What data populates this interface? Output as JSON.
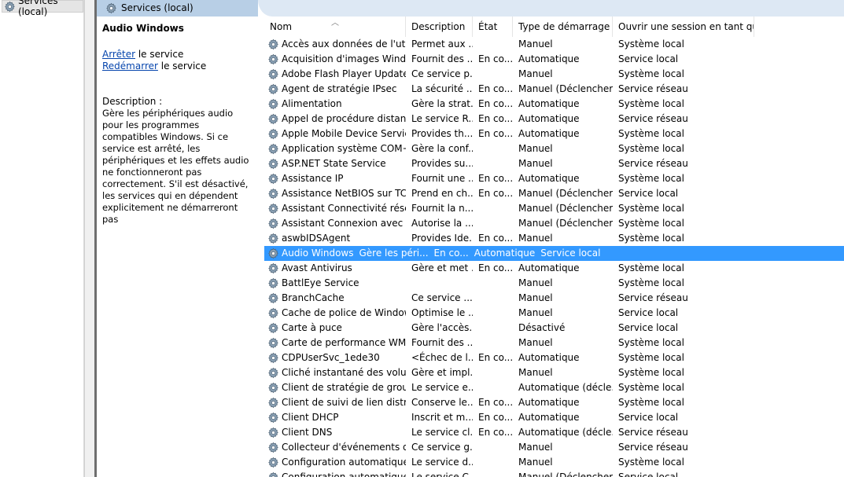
{
  "tree": {
    "root_label": "Services (local)"
  },
  "band": {
    "title": "Services (local)"
  },
  "details": {
    "service_name": "Audio Windows",
    "stop_link": "Arrêter",
    "stop_suffix": " le service",
    "restart_link": "Redémarrer",
    "restart_suffix": " le service",
    "description_label": "Description :",
    "description_text": "Gère les périphériques audio pour les programmes compatibles Windows. Si ce service est arrêté, les périphériques et les effets audio ne fonctionneront pas correctement. S'il est désactivé, les services qui en dépendent explicitement ne démarreront pas"
  },
  "columns": [
    "Nom",
    "Description",
    "État",
    "Type de démarrage",
    "Ouvrir une session en tant que"
  ],
  "selected_index": 14,
  "rows": [
    [
      "Accès aux données de l'utili...",
      "Permet aux ...",
      "",
      "Manuel",
      "Système local"
    ],
    [
      "Acquisition d'images Wind...",
      "Fournit des ...",
      "En co...",
      "Automatique",
      "Service local"
    ],
    [
      "Adobe Flash Player Update ...",
      "Ce service p...",
      "",
      "Manuel",
      "Système local"
    ],
    [
      "Agent de stratégie IPsec",
      "La sécurité ...",
      "En co...",
      "Manuel (Déclencher...",
      "Service réseau"
    ],
    [
      "Alimentation",
      "Gère la strat...",
      "En co...",
      "Automatique",
      "Système local"
    ],
    [
      "Appel de procédure distant...",
      "Le service R...",
      "En co...",
      "Automatique",
      "Service réseau"
    ],
    [
      "Apple Mobile Device Service",
      "Provides th...",
      "En co...",
      "Automatique",
      "Système local"
    ],
    [
      "Application système COM+",
      "Gère la conf...",
      "",
      "Manuel",
      "Système local"
    ],
    [
      "ASP.NET State Service",
      "Provides su...",
      "",
      "Manuel",
      "Service réseau"
    ],
    [
      "Assistance IP",
      "Fournit une ...",
      "En co...",
      "Automatique",
      "Système local"
    ],
    [
      "Assistance NetBIOS sur TCP...",
      "Prend en ch...",
      "En co...",
      "Manuel (Déclencher...",
      "Service local"
    ],
    [
      "Assistant Connectivité réseau",
      "Fournit la n...",
      "",
      "Manuel (Déclencher...",
      "Système local"
    ],
    [
      "Assistant Connexion avec u...",
      "Autorise la ...",
      "",
      "Manuel (Déclencher...",
      "Système local"
    ],
    [
      "aswbIDSAgent",
      "Provides Ide...",
      "En co...",
      "Manuel",
      "Système local"
    ],
    [
      "Audio Windows",
      "Gère les péri...",
      "En co...",
      "Automatique",
      "Service local"
    ],
    [
      "Avast Antivirus",
      "Gère et met ...",
      "En co...",
      "Automatique",
      "Système local"
    ],
    [
      "BattlEye Service",
      "",
      "",
      "Manuel",
      "Système local"
    ],
    [
      "BranchCache",
      "Ce service ...",
      "",
      "Manuel",
      "Service réseau"
    ],
    [
      "Cache de police de Window...",
      "Optimise le ...",
      "",
      "Manuel",
      "Service local"
    ],
    [
      "Carte à puce",
      "Gère l'accès...",
      "",
      "Désactivé",
      "Service local"
    ],
    [
      "Carte de performance WMI",
      "Fournit des ...",
      "",
      "Manuel",
      "Système local"
    ],
    [
      "CDPUserSvc_1ede30",
      "<Échec de l...",
      "En co...",
      "Automatique",
      "Système local"
    ],
    [
      "Cliché instantané des volu...",
      "Gère et impl...",
      "",
      "Manuel",
      "Système local"
    ],
    [
      "Client de stratégie de groupe",
      "Le service e...",
      "",
      "Automatique (décle...",
      "Système local"
    ],
    [
      "Client de suivi de lien distri...",
      "Conserve le...",
      "En co...",
      "Automatique",
      "Système local"
    ],
    [
      "Client DHCP",
      "Inscrit et m...",
      "En co...",
      "Automatique",
      "Service local"
    ],
    [
      "Client DNS",
      "Le service cl...",
      "En co...",
      "Automatique (décle...",
      "Service réseau"
    ],
    [
      "Collecteur d'événements de...",
      "Ce service g...",
      "",
      "Manuel",
      "Service réseau"
    ],
    [
      "Configuration automatique...",
      "Le service d...",
      "",
      "Manuel",
      "Système local"
    ],
    [
      "Configuration automatique...",
      "Le service C...",
      "",
      "Manuel (Déclencher...",
      "Service local"
    ]
  ]
}
